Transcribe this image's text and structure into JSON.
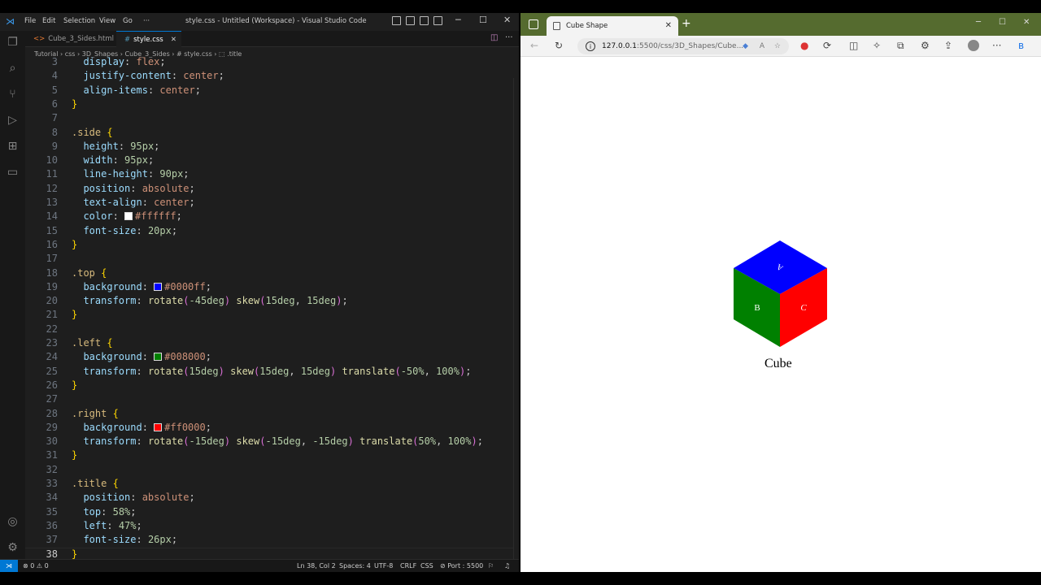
{
  "vscode": {
    "menu": [
      "File",
      "Edit",
      "Selection",
      "View",
      "Go",
      "···"
    ],
    "window_title": "style.css - Untitled (Workspace) - Visual Studio Code",
    "tabs": [
      {
        "label": "Cube_3_Sides.html",
        "icon": "html-file-icon",
        "active": false
      },
      {
        "label": "style.css",
        "icon": "css-file-icon",
        "active": true
      }
    ],
    "breadcrumb": [
      "Tutorial",
      "css",
      "3D_Shapes",
      "Cube_3_Sides",
      "# style.css",
      "⬚ .title"
    ],
    "code_lines": [
      {
        "n": "3",
        "tokens": [
          [
            "  ",
            "pun"
          ],
          [
            "display",
            "prop"
          ],
          [
            ": ",
            "pun"
          ],
          [
            "flex",
            "val"
          ],
          [
            ";",
            "pun"
          ]
        ]
      },
      {
        "n": "4",
        "tokens": [
          [
            "  ",
            "pun"
          ],
          [
            "justify-content",
            "prop"
          ],
          [
            ": ",
            "pun"
          ],
          [
            "center",
            "val"
          ],
          [
            ";",
            "pun"
          ]
        ]
      },
      {
        "n": "5",
        "tokens": [
          [
            "  ",
            "pun"
          ],
          [
            "align-items",
            "prop"
          ],
          [
            ": ",
            "pun"
          ],
          [
            "center",
            "val"
          ],
          [
            ";",
            "pun"
          ]
        ]
      },
      {
        "n": "6",
        "tokens": [
          [
            "}",
            "br"
          ]
        ]
      },
      {
        "n": "7",
        "tokens": []
      },
      {
        "n": "8",
        "tokens": [
          [
            ".side",
            "sel"
          ],
          [
            " ",
            "pun"
          ],
          [
            "{",
            "br"
          ]
        ]
      },
      {
        "n": "9",
        "tokens": [
          [
            "  ",
            "pun"
          ],
          [
            "height",
            "prop"
          ],
          [
            ": ",
            "pun"
          ],
          [
            "95px",
            "num"
          ],
          [
            ";",
            "pun"
          ]
        ]
      },
      {
        "n": "10",
        "tokens": [
          [
            "  ",
            "pun"
          ],
          [
            "width",
            "prop"
          ],
          [
            ": ",
            "pun"
          ],
          [
            "95px",
            "num"
          ],
          [
            ";",
            "pun"
          ]
        ]
      },
      {
        "n": "11",
        "tokens": [
          [
            "  ",
            "pun"
          ],
          [
            "line-height",
            "prop"
          ],
          [
            ": ",
            "pun"
          ],
          [
            "90px",
            "num"
          ],
          [
            ";",
            "pun"
          ]
        ]
      },
      {
        "n": "12",
        "tokens": [
          [
            "  ",
            "pun"
          ],
          [
            "position",
            "prop"
          ],
          [
            ": ",
            "pun"
          ],
          [
            "absolute",
            "val"
          ],
          [
            ";",
            "pun"
          ]
        ]
      },
      {
        "n": "13",
        "tokens": [
          [
            "  ",
            "pun"
          ],
          [
            "text-align",
            "prop"
          ],
          [
            ": ",
            "pun"
          ],
          [
            "center",
            "val"
          ],
          [
            ";",
            "pun"
          ]
        ]
      },
      {
        "n": "14",
        "tokens": [
          [
            "  ",
            "pun"
          ],
          [
            "color",
            "prop"
          ],
          [
            ": ",
            "pun"
          ],
          [
            "#ffffff",
            "swatch:#ffffff"
          ],
          [
            "#ffffff",
            "val"
          ],
          [
            ";",
            "pun"
          ]
        ]
      },
      {
        "n": "15",
        "tokens": [
          [
            "  ",
            "pun"
          ],
          [
            "font-size",
            "prop"
          ],
          [
            ": ",
            "pun"
          ],
          [
            "20px",
            "num"
          ],
          [
            ";",
            "pun"
          ]
        ]
      },
      {
        "n": "16",
        "tokens": [
          [
            "}",
            "br"
          ]
        ]
      },
      {
        "n": "17",
        "tokens": []
      },
      {
        "n": "18",
        "tokens": [
          [
            ".top",
            "sel"
          ],
          [
            " ",
            "pun"
          ],
          [
            "{",
            "br"
          ]
        ]
      },
      {
        "n": "19",
        "tokens": [
          [
            "  ",
            "pun"
          ],
          [
            "background",
            "prop"
          ],
          [
            ": ",
            "pun"
          ],
          [
            "#0000ff",
            "swatch:#0000ff"
          ],
          [
            "#0000ff",
            "val"
          ],
          [
            ";",
            "pun"
          ]
        ]
      },
      {
        "n": "20",
        "tokens": [
          [
            "  ",
            "pun"
          ],
          [
            "transform",
            "prop"
          ],
          [
            ": ",
            "pun"
          ],
          [
            "rotate",
            "fn"
          ],
          [
            "(",
            "br2"
          ],
          [
            "-45deg",
            "num"
          ],
          [
            ")",
            "br2"
          ],
          [
            " ",
            "pun"
          ],
          [
            "skew",
            "fn"
          ],
          [
            "(",
            "br2"
          ],
          [
            "15deg",
            "num"
          ],
          [
            ", ",
            "pun"
          ],
          [
            "15deg",
            "num"
          ],
          [
            ")",
            "br2"
          ],
          [
            ";",
            "pun"
          ]
        ]
      },
      {
        "n": "21",
        "tokens": [
          [
            "}",
            "br"
          ]
        ]
      },
      {
        "n": "22",
        "tokens": []
      },
      {
        "n": "23",
        "tokens": [
          [
            ".left",
            "sel"
          ],
          [
            " ",
            "pun"
          ],
          [
            "{",
            "br"
          ]
        ]
      },
      {
        "n": "24",
        "tokens": [
          [
            "  ",
            "pun"
          ],
          [
            "background",
            "prop"
          ],
          [
            ": ",
            "pun"
          ],
          [
            "#008000",
            "swatch:#008000"
          ],
          [
            "#008000",
            "val"
          ],
          [
            ";",
            "pun"
          ]
        ]
      },
      {
        "n": "25",
        "tokens": [
          [
            "  ",
            "pun"
          ],
          [
            "transform",
            "prop"
          ],
          [
            ": ",
            "pun"
          ],
          [
            "rotate",
            "fn"
          ],
          [
            "(",
            "br2"
          ],
          [
            "15deg",
            "num"
          ],
          [
            ")",
            "br2"
          ],
          [
            " ",
            "pun"
          ],
          [
            "skew",
            "fn"
          ],
          [
            "(",
            "br2"
          ],
          [
            "15deg",
            "num"
          ],
          [
            ", ",
            "pun"
          ],
          [
            "15deg",
            "num"
          ],
          [
            ")",
            "br2"
          ],
          [
            " ",
            "pun"
          ],
          [
            "translate",
            "fn"
          ],
          [
            "(",
            "br2"
          ],
          [
            "-50%",
            "num"
          ],
          [
            ", ",
            "pun"
          ],
          [
            "100%",
            "num"
          ],
          [
            ")",
            "br2"
          ],
          [
            ";",
            "pun"
          ]
        ]
      },
      {
        "n": "26",
        "tokens": [
          [
            "}",
            "br"
          ]
        ]
      },
      {
        "n": "27",
        "tokens": []
      },
      {
        "n": "28",
        "tokens": [
          [
            ".right",
            "sel"
          ],
          [
            " ",
            "pun"
          ],
          [
            "{",
            "br"
          ]
        ]
      },
      {
        "n": "29",
        "tokens": [
          [
            "  ",
            "pun"
          ],
          [
            "background",
            "prop"
          ],
          [
            ": ",
            "pun"
          ],
          [
            "#ff0000",
            "swatch:#ff0000"
          ],
          [
            "#ff0000",
            "val"
          ],
          [
            ";",
            "pun"
          ]
        ]
      },
      {
        "n": "30",
        "tokens": [
          [
            "  ",
            "pun"
          ],
          [
            "transform",
            "prop"
          ],
          [
            ": ",
            "pun"
          ],
          [
            "rotate",
            "fn"
          ],
          [
            "(",
            "br2"
          ],
          [
            "-15deg",
            "num"
          ],
          [
            ")",
            "br2"
          ],
          [
            " ",
            "pun"
          ],
          [
            "skew",
            "fn"
          ],
          [
            "(",
            "br2"
          ],
          [
            "-15deg",
            "num"
          ],
          [
            ", ",
            "pun"
          ],
          [
            "-15deg",
            "num"
          ],
          [
            ")",
            "br2"
          ],
          [
            " ",
            "pun"
          ],
          [
            "translate",
            "fn"
          ],
          [
            "(",
            "br2"
          ],
          [
            "50%",
            "num"
          ],
          [
            ", ",
            "pun"
          ],
          [
            "100%",
            "num"
          ],
          [
            ")",
            "br2"
          ],
          [
            ";",
            "pun"
          ]
        ]
      },
      {
        "n": "31",
        "tokens": [
          [
            "}",
            "br"
          ]
        ]
      },
      {
        "n": "32",
        "tokens": []
      },
      {
        "n": "33",
        "tokens": [
          [
            ".title",
            "sel"
          ],
          [
            " ",
            "pun"
          ],
          [
            "{",
            "br"
          ]
        ]
      },
      {
        "n": "34",
        "tokens": [
          [
            "  ",
            "pun"
          ],
          [
            "position",
            "prop"
          ],
          [
            ": ",
            "pun"
          ],
          [
            "absolute",
            "val"
          ],
          [
            ";",
            "pun"
          ]
        ]
      },
      {
        "n": "35",
        "tokens": [
          [
            "  ",
            "pun"
          ],
          [
            "top",
            "prop"
          ],
          [
            ": ",
            "pun"
          ],
          [
            "58%",
            "num"
          ],
          [
            ";",
            "pun"
          ]
        ]
      },
      {
        "n": "36",
        "tokens": [
          [
            "  ",
            "pun"
          ],
          [
            "left",
            "prop"
          ],
          [
            ": ",
            "pun"
          ],
          [
            "47%",
            "num"
          ],
          [
            ";",
            "pun"
          ]
        ]
      },
      {
        "n": "37",
        "tokens": [
          [
            "  ",
            "pun"
          ],
          [
            "font-size",
            "prop"
          ],
          [
            ": ",
            "pun"
          ],
          [
            "26px",
            "num"
          ],
          [
            ";",
            "pun"
          ]
        ]
      },
      {
        "n": "38",
        "tokens": [
          [
            "}",
            "br"
          ]
        ]
      }
    ],
    "current_line": "38",
    "status": {
      "errors": "0",
      "warnings": "0",
      "position": "Ln 38, Col 2",
      "spaces": "Spaces: 4",
      "encoding": "UTF-8",
      "eol": "CRLF",
      "language": "CSS",
      "port": "Port : 5500"
    }
  },
  "browser": {
    "tab_title": "Cube Shape",
    "url_host": "127.0.0.1",
    "url_path": ":5500/css/3D_Shapes/Cube...",
    "page": {
      "faces": [
        {
          "label": "A",
          "color": "#0000ff"
        },
        {
          "label": "B",
          "color": "#008000"
        },
        {
          "label": "C",
          "color": "#ff0000"
        }
      ],
      "title": "Cube"
    }
  },
  "colors": {
    "accent": "#0078d4",
    "browser_tabbar": "#556b2f"
  }
}
